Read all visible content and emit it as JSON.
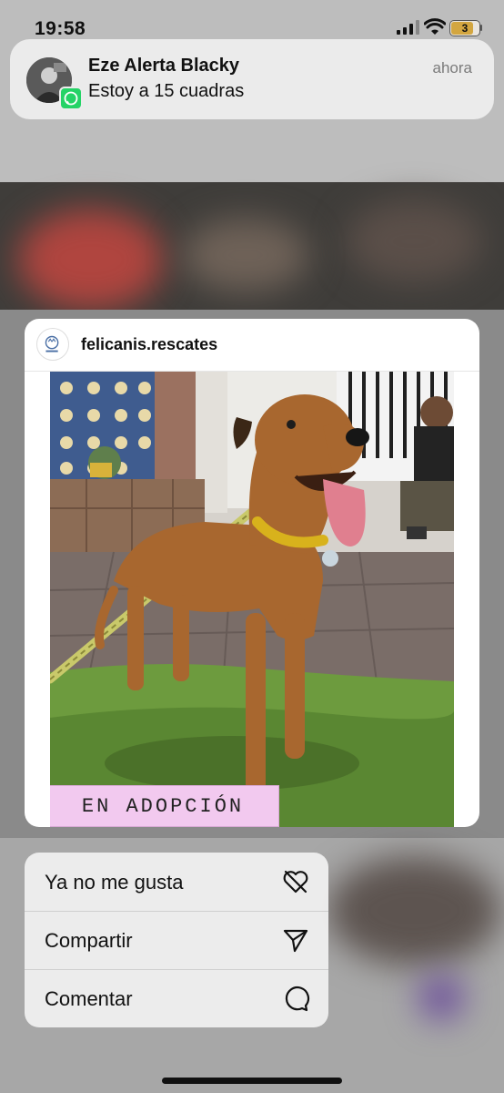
{
  "status_bar": {
    "time": "19:58",
    "battery_level": "3"
  },
  "notification": {
    "app_icon": "whatsapp-icon",
    "title": "Eze Alerta Blacky",
    "message": "Estoy a 15 cuadras",
    "time": "ahora"
  },
  "post": {
    "username": "felicanis.rescates",
    "image_caption": "EN ADOPCIÓN"
  },
  "menu": {
    "items": [
      {
        "label": "Ya no me gusta",
        "icon": "heart-slash-icon"
      },
      {
        "label": "Compartir",
        "icon": "paper-plane-icon"
      },
      {
        "label": "Comentar",
        "icon": "comment-bubble-icon"
      }
    ]
  },
  "colors": {
    "notification_bg": "#ececec",
    "whatsapp_green": "#25d366",
    "caption_pink": "#f2c9ef",
    "battery_fill": "#d3a640"
  }
}
